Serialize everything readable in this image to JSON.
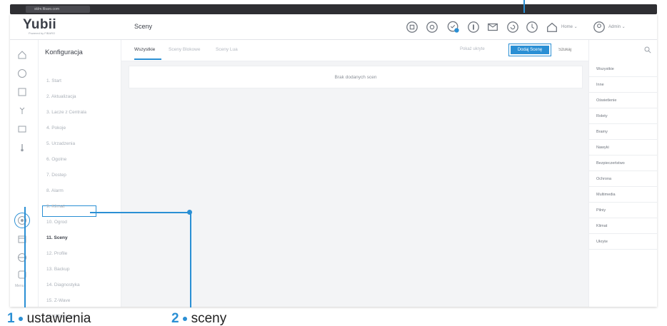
{
  "browser": {
    "url": "sklm.fibaro.com"
  },
  "header": {
    "logo": "Yubii",
    "logo_sub": "Powered by FIBARO",
    "title": "Sceny",
    "home_label": "Home",
    "admin_label": "Admin",
    "icons": [
      "power-icon",
      "vision-icon",
      "notification-icon",
      "info-icon",
      "mail-icon",
      "refresh-icon",
      "clock-icon",
      "home-icon",
      "user-icon"
    ]
  },
  "rail": {
    "icons": [
      "home-icon",
      "clock-icon",
      "device-icon",
      "plant-icon",
      "panel-icon",
      "thermometer-icon",
      "settings-icon",
      "calendar-icon",
      "globe-icon",
      "gateway-icon"
    ],
    "bottom_text": "Menu"
  },
  "config": {
    "title": "Konfiguracja",
    "items": [
      "1. Start",
      "2. Aktualizacja",
      "3. Lacze z Centrala",
      "4. Pokoje",
      "5. Urzadzenia",
      "6. Ogolne",
      "7. Dostep",
      "8. Alarm",
      "9. Klimat",
      "10. Ogrod",
      "11. Sceny",
      "12. Profile",
      "13. Backup",
      "14. Diagnostyka",
      "15. Z-Wave",
      "16. Wzorcowe"
    ],
    "active_index": 10
  },
  "tabs": [
    {
      "label": "Wszystkie",
      "active": true
    },
    {
      "label": "Sceny Blokowe",
      "active": false
    },
    {
      "label": "Sceny Lua",
      "active": false
    }
  ],
  "toolbar": {
    "hidden_label": "Pokaż ukryte",
    "add_scene": "Dodaj Scenę",
    "search_placeholder": "Szukaj"
  },
  "main": {
    "empty_message": "Brak dodanych scen"
  },
  "categories": [
    "Wszystkie",
    "Inne",
    "Oświetlenie",
    "Rolety",
    "Bramy",
    "Nawyki",
    "Bezpieczeństwo",
    "Ochrona",
    "Multimedia",
    "Pilniy",
    "Klimat",
    "Ukryte"
  ],
  "legend": [
    {
      "num": "1",
      "label": "ustawienia"
    },
    {
      "num": "2",
      "label": "sceny"
    }
  ],
  "colors": {
    "accent": "#2a8fd4",
    "text": "#3b3f48",
    "muted": "#aab0b8"
  }
}
